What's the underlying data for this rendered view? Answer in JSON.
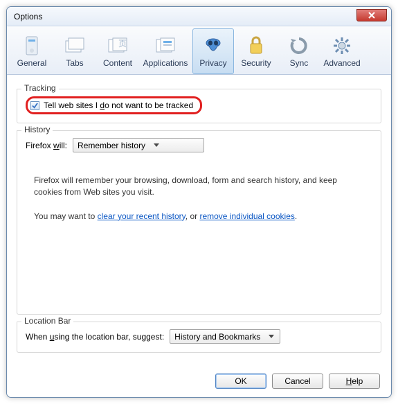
{
  "window": {
    "title": "Options"
  },
  "tabs": {
    "general": "General",
    "tabs": "Tabs",
    "content": "Content",
    "applications": "Applications",
    "privacy": "Privacy",
    "security": "Security",
    "sync": "Sync",
    "advanced": "Advanced"
  },
  "tracking": {
    "legend": "Tracking",
    "checkbox_label_pre": "Tell web sites I ",
    "checkbox_label_u": "d",
    "checkbox_label_post": "o not want to be tracked",
    "checked": true
  },
  "history": {
    "legend": "History",
    "prefix_pre": "Firefox ",
    "prefix_u": "w",
    "prefix_post": "ill:",
    "select_value": "Remember history",
    "info1": "Firefox will remember your browsing, download, form and search history, and keep cookies from Web sites you visit.",
    "info2_pre": "You may want to ",
    "info2_link1": "clear your recent history",
    "info2_mid": ", or ",
    "info2_link2": "remove individual cookies",
    "info2_post": "."
  },
  "locationbar": {
    "legend": "Location Bar",
    "label_pre": "When ",
    "label_u": "u",
    "label_post": "sing the location bar, suggest:",
    "select_value": "History and Bookmarks"
  },
  "buttons": {
    "ok": "OK",
    "cancel": "Cancel",
    "help_u": "H",
    "help_post": "elp"
  }
}
